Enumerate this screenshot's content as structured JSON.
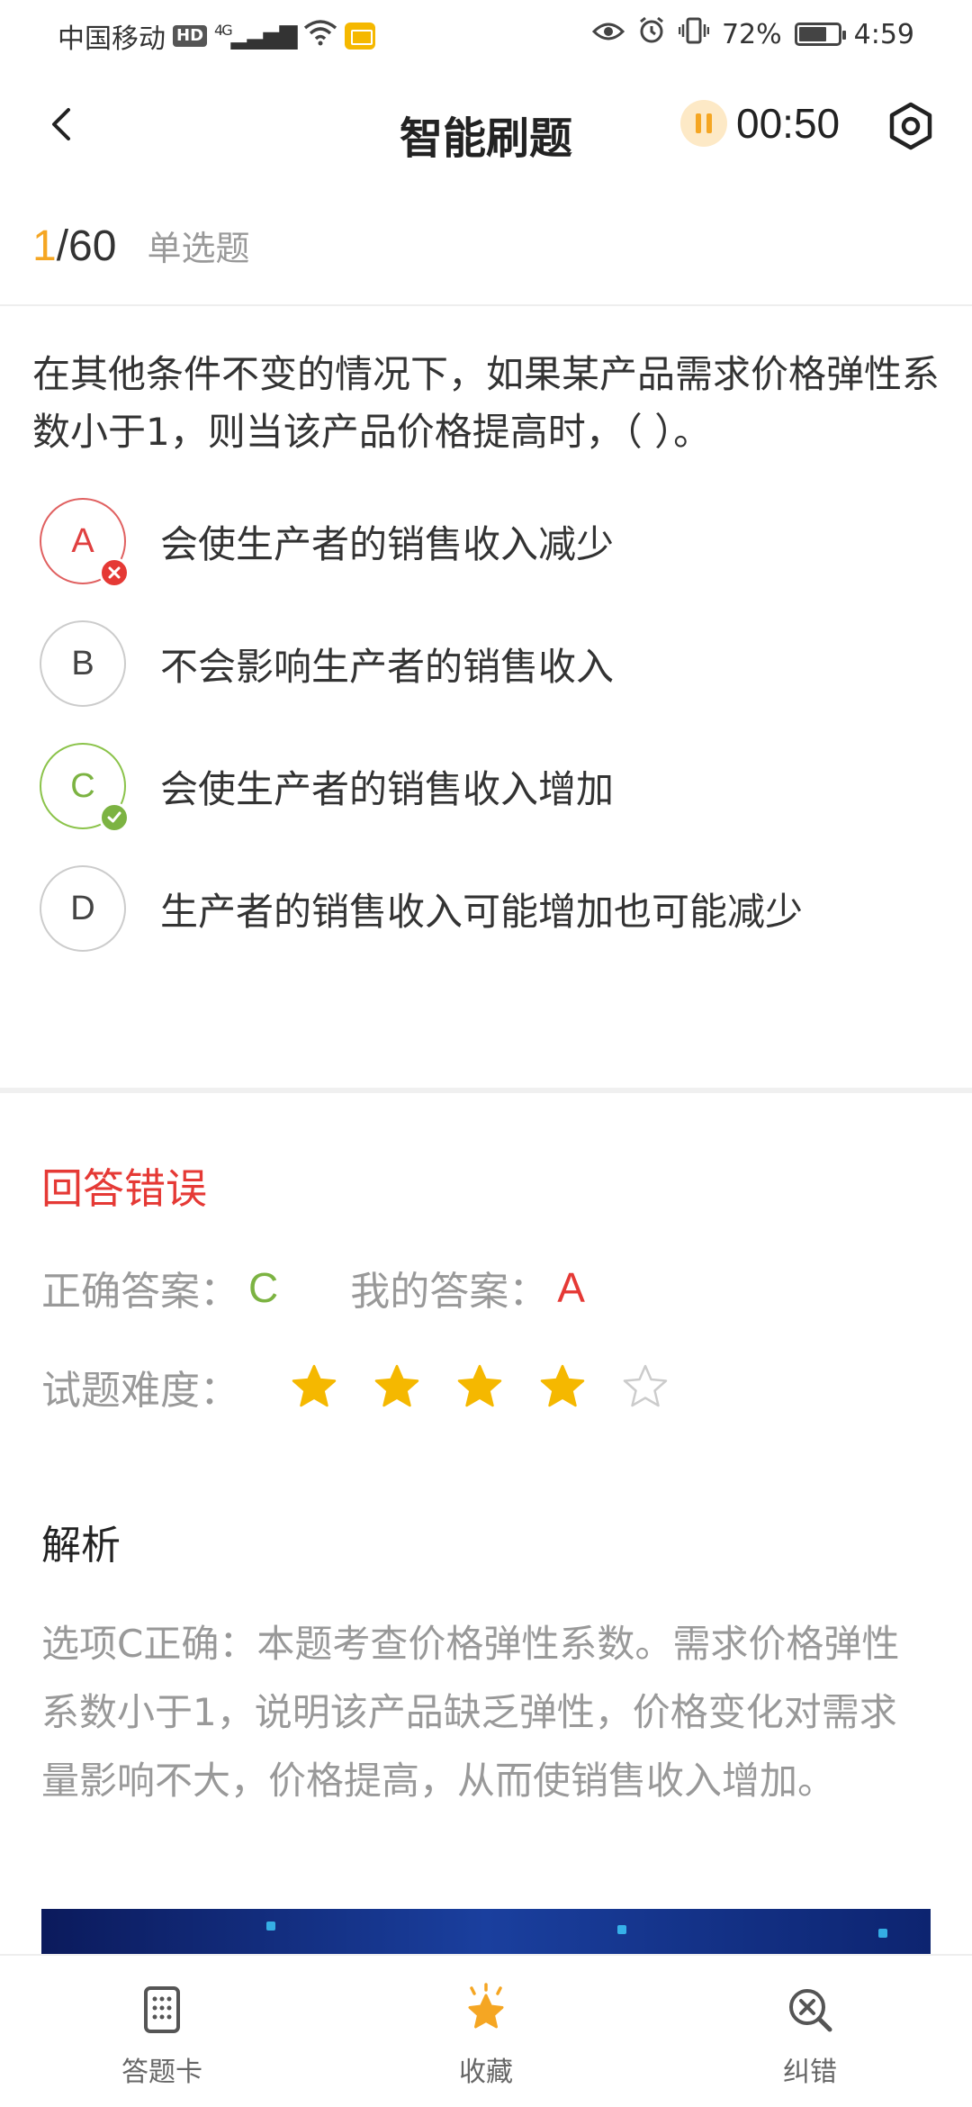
{
  "status_bar": {
    "carrier": "中国移动",
    "hd": "HD",
    "network": "4G",
    "battery": "72%",
    "battery_level": 0.72,
    "time": "4:59"
  },
  "header": {
    "title": "智能刷题",
    "timer": "00:50"
  },
  "progress": {
    "current": "1",
    "total": "/60",
    "type": "单选题"
  },
  "question": {
    "text": "在其他条件不变的情况下，如果某产品需求价格弹性系数小于1，则当该产品价格提高时，（ ）。",
    "options": [
      {
        "letter": "A",
        "text": "会使生产者的销售收入减少",
        "state": "wrong"
      },
      {
        "letter": "B",
        "text": "不会影响生产者的销售收入",
        "state": "normal"
      },
      {
        "letter": "C",
        "text": "会使生产者的销售收入增加",
        "state": "right"
      },
      {
        "letter": "D",
        "text": "生产者的销售收入可能增加也可能减少",
        "state": "normal"
      }
    ]
  },
  "result": {
    "title": "回答错误",
    "correct_label": "正确答案：",
    "correct_value": "C",
    "mine_label": "我的答案：",
    "mine_value": "A",
    "difficulty_label": "试题难度：",
    "difficulty_rating": 4,
    "difficulty_max": 5
  },
  "analysis": {
    "title": "解析",
    "text": "选项C正确：本题考查价格弹性系数。需求价格弹性系数小于1，说明该产品缺乏弹性，价格变化对需求量影响不大，价格提高，从而使销售收入增加。"
  },
  "bottom_nav": {
    "answer_card": "答题卡",
    "favorite": "收藏",
    "report_error": "纠错"
  },
  "colors": {
    "accent": "#f5a623",
    "wrong": "#e53935",
    "right": "#7cb342",
    "star": "#f5b800"
  }
}
